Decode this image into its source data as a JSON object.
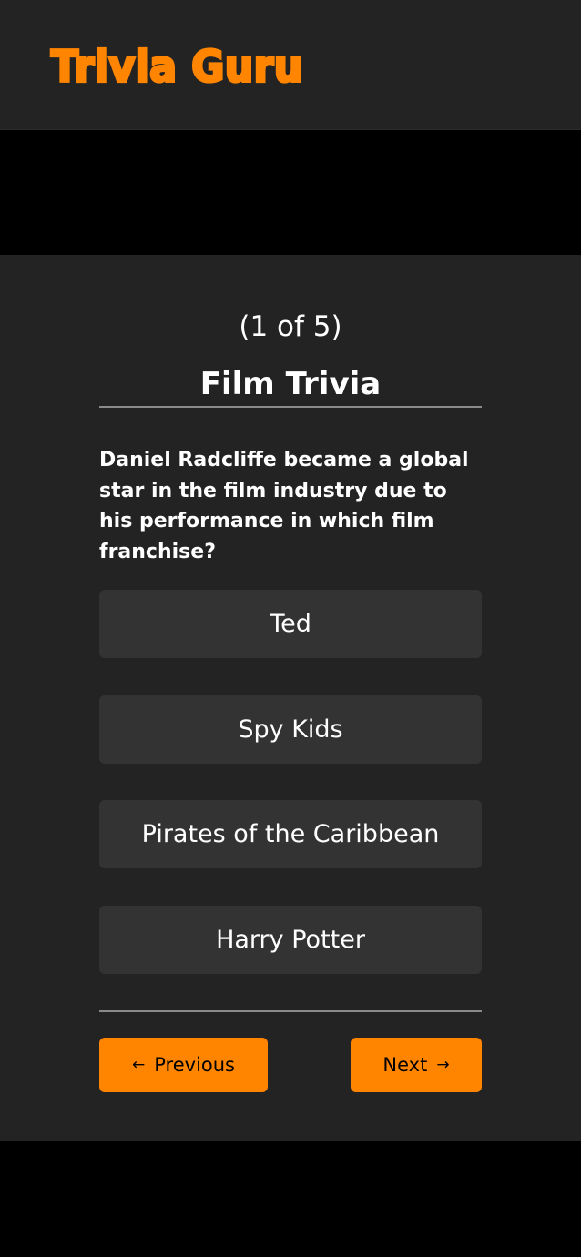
{
  "app": {
    "title": "Trivia Guru",
    "brand_color": "#ff8500"
  },
  "quiz": {
    "progress": "(1 of 5)",
    "current_index": 1,
    "total": 5,
    "category": "Film Trivia",
    "question": "Daniel Radcliffe became a global star in the film industry due to his performance in which film franchise?",
    "answers": [
      "Ted",
      "Spy Kids",
      "Pirates of the Caribbean",
      "Harry Potter"
    ]
  },
  "nav": {
    "previous_label": "Previous",
    "next_label": "Next",
    "previous_icon": "arrow-left-icon",
    "next_icon": "arrow-right-icon"
  }
}
